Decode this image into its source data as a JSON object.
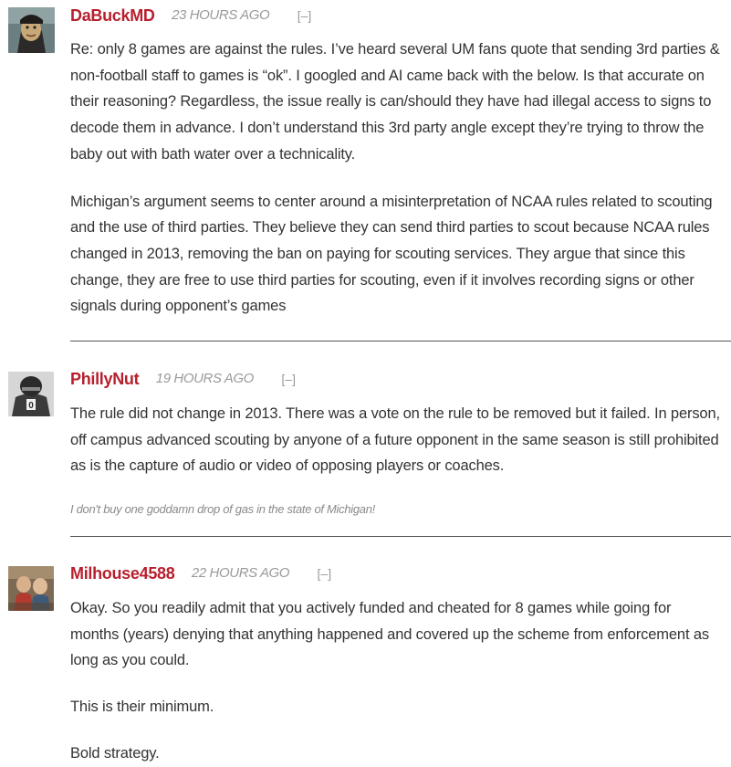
{
  "comments": [
    {
      "username": "DaBuckMD",
      "time": "23 HOURS AGO",
      "collapse": "[–]",
      "paragraphs": [
        "Re: only 8 games are against the rules.  I’ve heard several UM fans quote that sending 3rd parties & non-football staff to games is “ok”.  I googled and AI came back with the below.  Is that accurate on their reasoning?  Regardless, the issue really is can/should they have had illegal access to signs to decode them in advance.  I don’t understand this 3rd party angle except they’re trying to throw the baby out with bath water over a technicality.",
        "Michigan’s argument seems to center around a misinterpretation of NCAA rules related to scouting and the use of third parties. They believe they can send third parties to scout because NCAA rules changed in 2013, removing the ban on paying for scouting services. They argue that since this change, they are free to use third parties for scouting, even if it involves recording signs or other signals during opponent’s games"
      ]
    },
    {
      "username": "PhillyNut",
      "time": "19 HOURS AGO",
      "collapse": "[–]",
      "paragraphs": [
        "The rule did not change in 2013. There was a vote on the rule to be removed but it failed. In person, off campus advanced scouting by anyone of a future opponent in the same season is still prohibited as is the capture of audio or video of opposing players or coaches."
      ],
      "signature": "I don't buy one goddamn drop of gas in the state of Michigan!"
    },
    {
      "username": "Milhouse4588",
      "time": "22 HOURS AGO",
      "collapse": "[–]",
      "paragraphs": [
        "Okay. So you readily admit that you actively funded and cheated for 8 games while going for months (years) denying that anything happened and covered up the scheme from enforcement as long as you could.",
        "This is their minimum.",
        "Bold strategy."
      ]
    }
  ],
  "colors": {
    "username": "#b81f2d",
    "meta": "#9a9a9a",
    "text": "#333333",
    "divider": "#555555"
  }
}
